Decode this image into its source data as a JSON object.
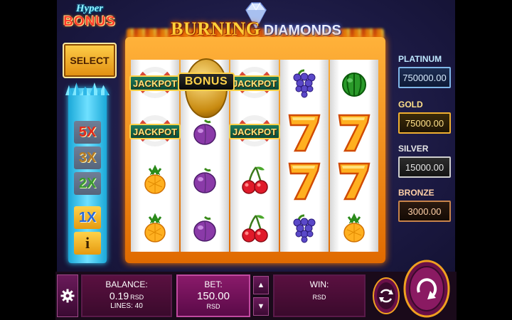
{
  "logo": {
    "word1": "BURNING",
    "word2": "DIAMONDS"
  },
  "hyper_bonus": {
    "line1": "Hyper",
    "line2": "BONUS",
    "select_label": "SELECT"
  },
  "multipliers": [
    {
      "label": "5X",
      "active": false
    },
    {
      "label": "3X",
      "active": false
    },
    {
      "label": "2X",
      "active": false
    },
    {
      "label": "1X",
      "active": true
    },
    {
      "label": "i",
      "active": true
    }
  ],
  "reels": [
    [
      "jackpot",
      "jackpot",
      "orange",
      "orange"
    ],
    [
      "bonus",
      "plum",
      "plum",
      "plum"
    ],
    [
      "jackpot",
      "jackpot",
      "cherry",
      "cherry"
    ],
    [
      "grapes",
      "seven",
      "seven",
      "grapes"
    ],
    [
      "watermelon",
      "seven",
      "seven",
      "orange"
    ]
  ],
  "symbol_labels": {
    "jackpot": "JACKPOT",
    "bonus": "BONUS"
  },
  "jackpots": [
    {
      "name": "PLATINUM",
      "value": "750000.00"
    },
    {
      "name": "GOLD",
      "value": "75000.00"
    },
    {
      "name": "SILVER",
      "value": "15000.00"
    },
    {
      "name": "BRONZE",
      "value": "3000.00"
    }
  ],
  "bottom": {
    "balance": {
      "title": "BALANCE:",
      "value": "0.19",
      "currency": "RSD",
      "lines": "LINES: 40"
    },
    "bet": {
      "title": "BET:",
      "value": "150.00",
      "currency": "RSD"
    },
    "win": {
      "title": "WIN:",
      "value": "",
      "currency": "RSD"
    }
  },
  "icons": {
    "settings": "gear-icon",
    "bet_up": "arrow-up-icon",
    "bet_down": "arrow-down-icon",
    "autoplay": "autoplay-icon",
    "spin": "spin-icon"
  },
  "colors": {
    "accent_gold": "#ffd24a",
    "panel_magenta": "#5a1040",
    "tower_cyan": "#32d0ff"
  }
}
